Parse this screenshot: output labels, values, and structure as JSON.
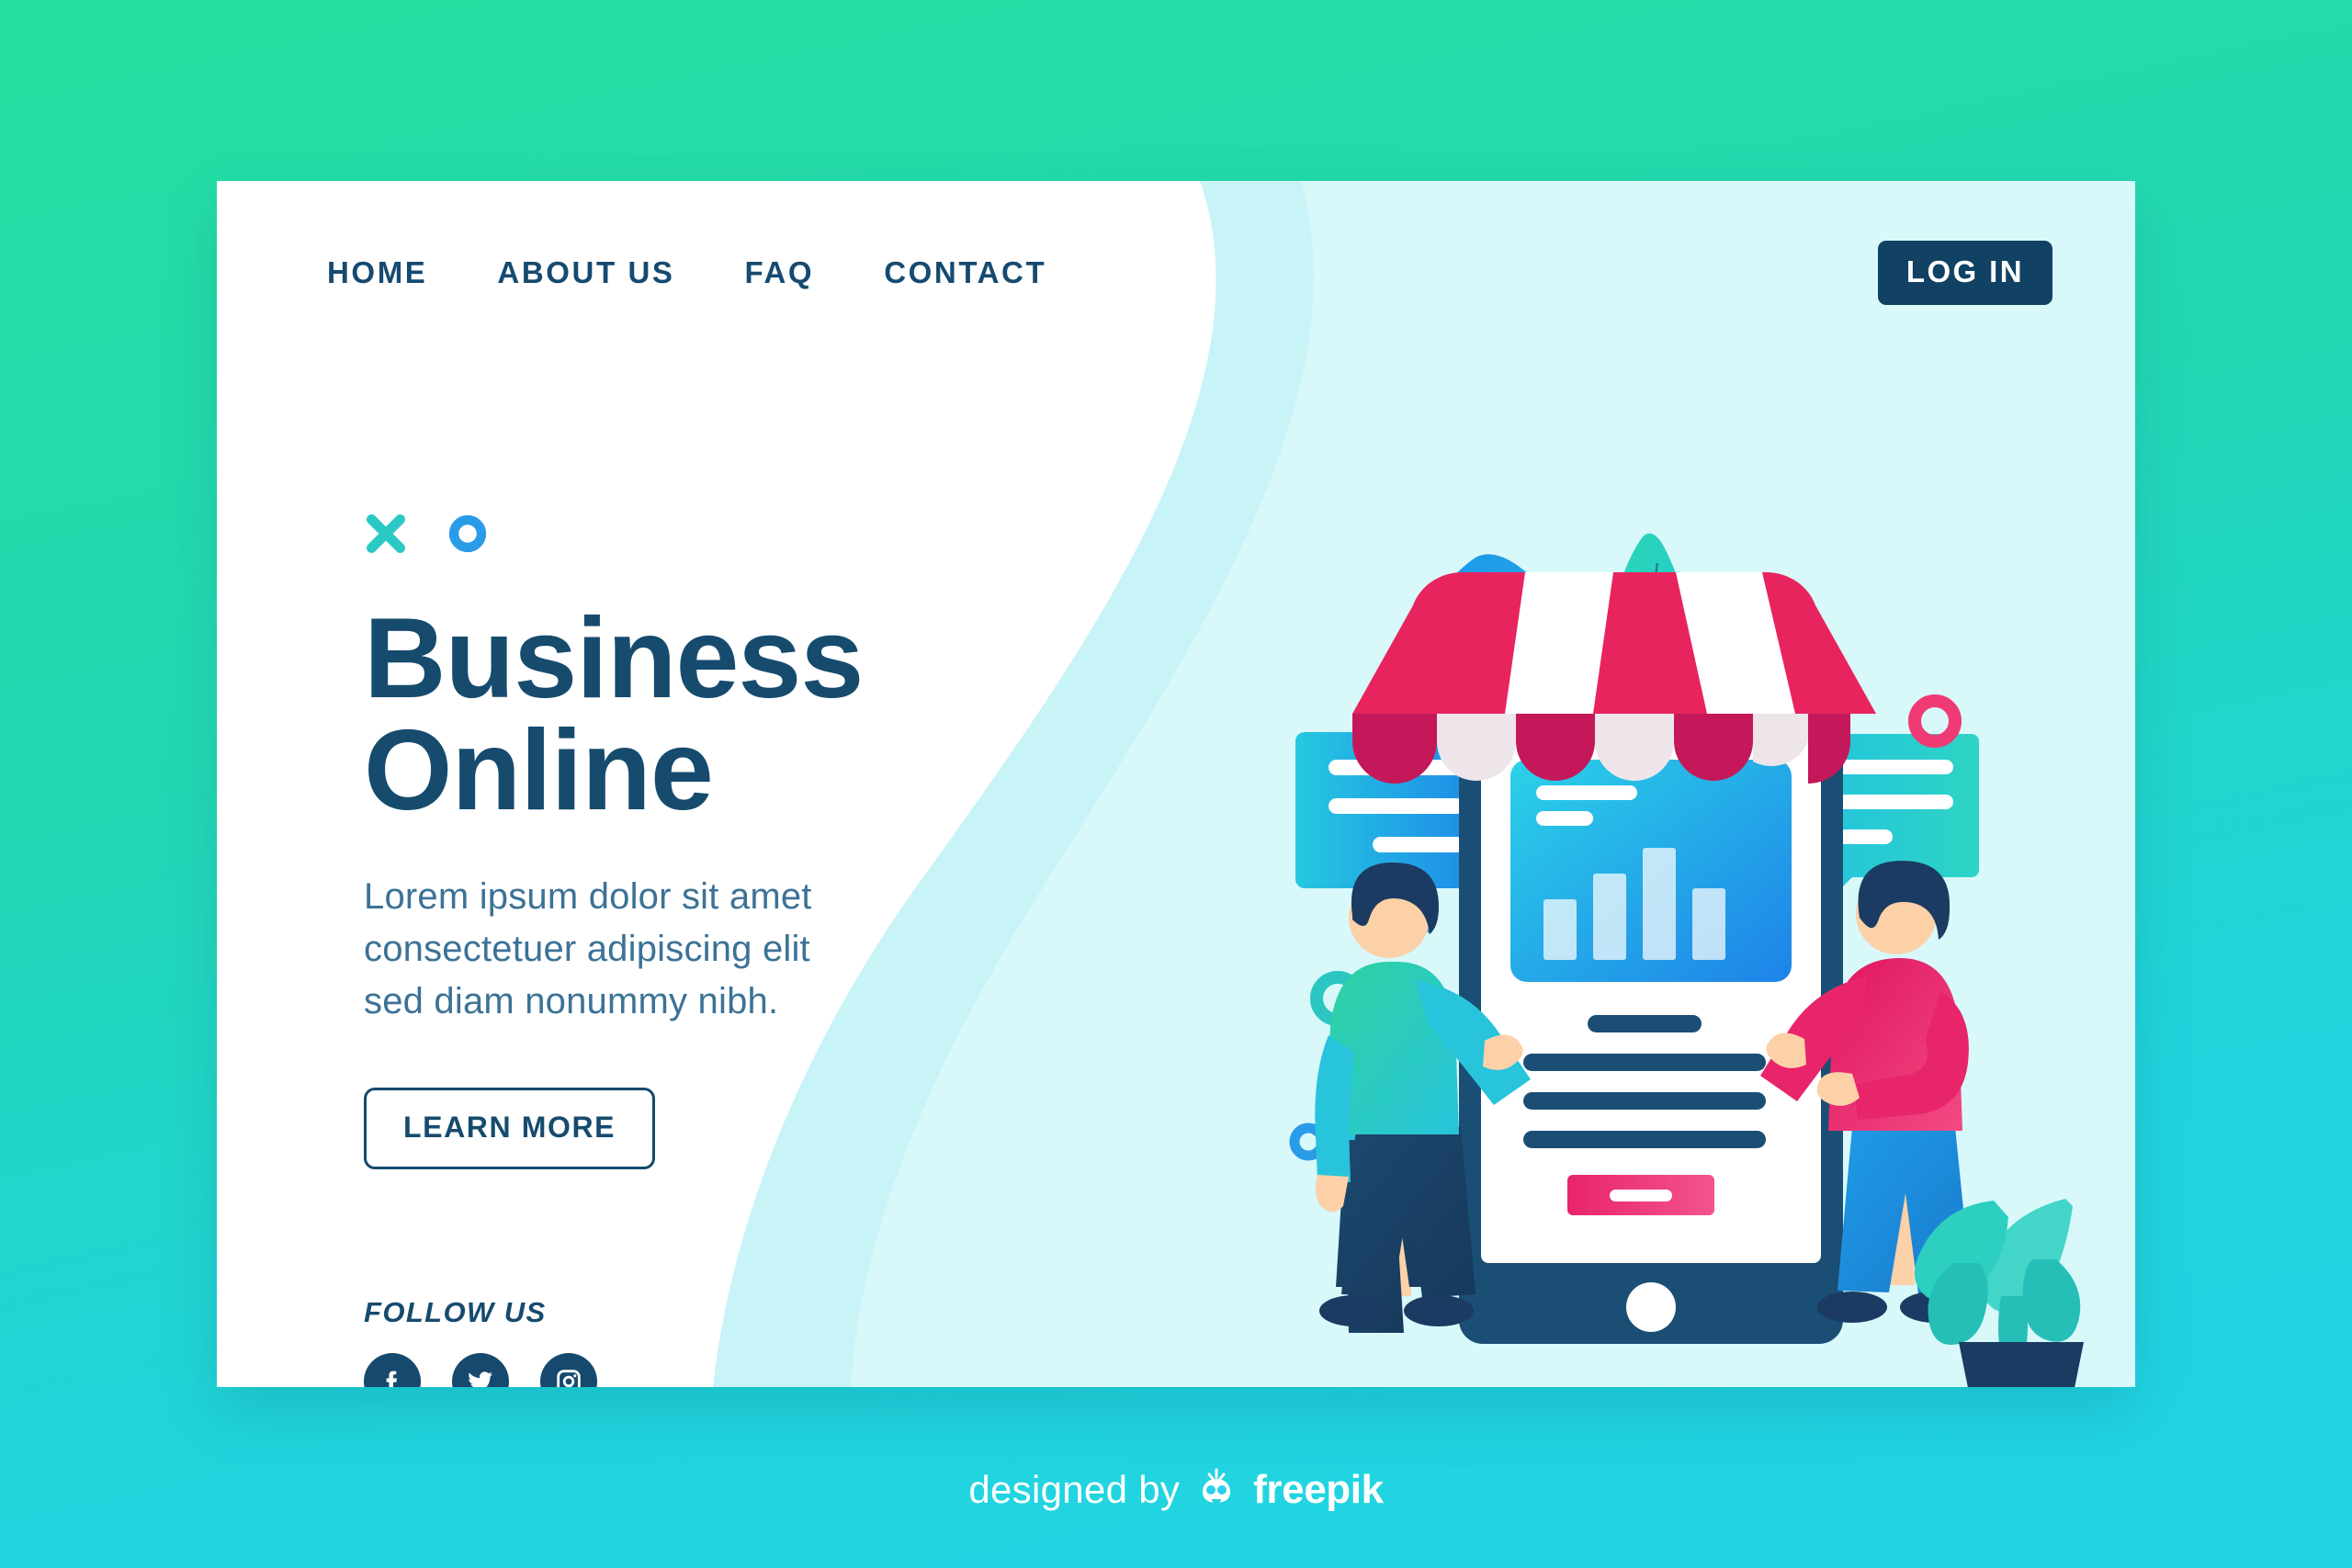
{
  "page": {
    "background_top_color": "#25DFA0",
    "background_bottom_color": "#22D3E6",
    "card_background": "#FFFFFF",
    "card_wave_color": "#C8F4F8",
    "accent_navy": "#164B6E",
    "accent_pink": "#E8245F",
    "accent_blue": "#23A8F2",
    "accent_teal": "#26D0C4"
  },
  "nav": {
    "links": [
      {
        "label": "HOME",
        "name": "nav-link-home"
      },
      {
        "label": "ABOUT US",
        "name": "nav-link-about-us"
      },
      {
        "label": "FAQ",
        "name": "nav-link-faq"
      },
      {
        "label": "CONTACT",
        "name": "nav-link-contact"
      }
    ],
    "login_label": "LOG IN"
  },
  "hero": {
    "decoration": {
      "x_icon": "x-mark-icon",
      "o_icon": "circle-outline-icon"
    },
    "title": "Business\nOnline",
    "subtitle": "Lorem ipsum dolor sit amet\nconsectetuer adipiscing elit\nsed diam nonummy nibh.",
    "cta_label": "LEARN MORE",
    "follow_label": "FOLLOW US",
    "socials": [
      {
        "name": "facebook-icon",
        "label": "Facebook"
      },
      {
        "name": "twitter-icon",
        "label": "Twitter"
      },
      {
        "name": "instagram-icon",
        "label": "Instagram"
      }
    ]
  },
  "illustration": {
    "description": "Two people standing beside a large smartphone styled as an online shop with a striped awning",
    "awning_stripe_colors": [
      "#E8245F",
      "#FFFFFF"
    ],
    "phone_body_color": "#1B4E74",
    "phone_screen_color": "#FFFFFF",
    "chart_card_gradient": [
      "#2BD2E8",
      "#1E82E8"
    ],
    "chart_bars": [
      30,
      58,
      78,
      48
    ],
    "phone_button_color": "#EC2B6B",
    "left_person": {
      "shirt": "#2ED2A8",
      "pants": "#1D4870",
      "hair": "#1B3B62"
    },
    "right_person": {
      "shirt": "#E8246B",
      "pants": "#1E9BE8",
      "hair": "#1B3B62"
    },
    "speech_bubble_left_gradient": [
      "#25C8E0",
      "#1E86E8"
    ],
    "speech_bubble_right_gradient": [
      "#2ED4C4",
      "#22C3E0"
    ],
    "plant_leaf_color": "#2CCFC0",
    "plant_pot_color": "#1B3B62",
    "decorations": [
      {
        "name": "cross-teal",
        "shape": "x",
        "color": "#26D0C4"
      },
      {
        "name": "ring-pink",
        "shape": "o",
        "color": "#F03A74"
      },
      {
        "name": "ring-teal",
        "shape": "o",
        "color": "#2CC6C2"
      },
      {
        "name": "ring-blue",
        "shape": "o",
        "color": "#2A9BE8"
      },
      {
        "name": "cross-pink",
        "shape": "x",
        "color": "#EC2B6B"
      },
      {
        "name": "cross-blue",
        "shape": "x",
        "color": "#2A9BE8"
      },
      {
        "name": "ring-pink-small",
        "shape": "o",
        "color": "#EC2B6B"
      }
    ]
  },
  "footer": {
    "text": "designed by",
    "brand": "freepik",
    "icon": "freepik-mascot-icon"
  }
}
